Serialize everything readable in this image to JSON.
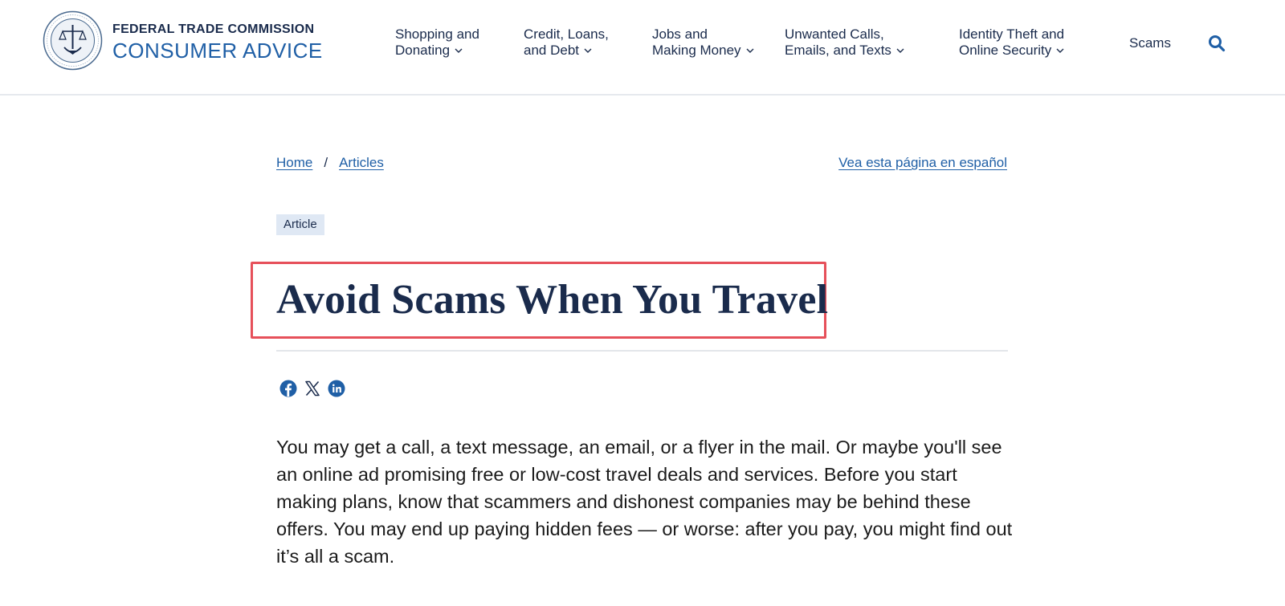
{
  "header": {
    "brand_top": "FEDERAL TRADE COMMISSION",
    "brand_bottom": "CONSUMER ADVICE",
    "nav": [
      {
        "line1": "Shopping and",
        "line2": "Donating"
      },
      {
        "line1": "Credit, Loans,",
        "line2": "and Debt"
      },
      {
        "line1": "Jobs and",
        "line2": "Making Money"
      },
      {
        "line1": "Unwanted Calls,",
        "line2": "Emails, and Texts"
      },
      {
        "line1": "Identity Theft and",
        "line2": "Online Security"
      }
    ],
    "nav_scams": "Scams"
  },
  "breadcrumb": {
    "home": "Home",
    "separator": "/",
    "articles": "Articles"
  },
  "spanish_link": "Vea esta página en español",
  "tag": "Article",
  "title": "Avoid Scams When You Travel",
  "share_icons": [
    "facebook-icon",
    "x-icon",
    "linkedin-icon"
  ],
  "intro": "You may get a call, a text message, an email, or a flyer in the mail. Or maybe you'll see an online ad promising free or low-cost travel deals and services. Before you start making plans, know that scammers and dishonest companies may be behind these offers. You may end up paying hidden fees — or worse: after you pay, you might find out it’s all a scam.",
  "colors": {
    "navy": "#1a2b4c",
    "link_blue": "#1f5fa6",
    "highlight_red": "#e6505a",
    "tag_bg": "#dfe8f4"
  }
}
